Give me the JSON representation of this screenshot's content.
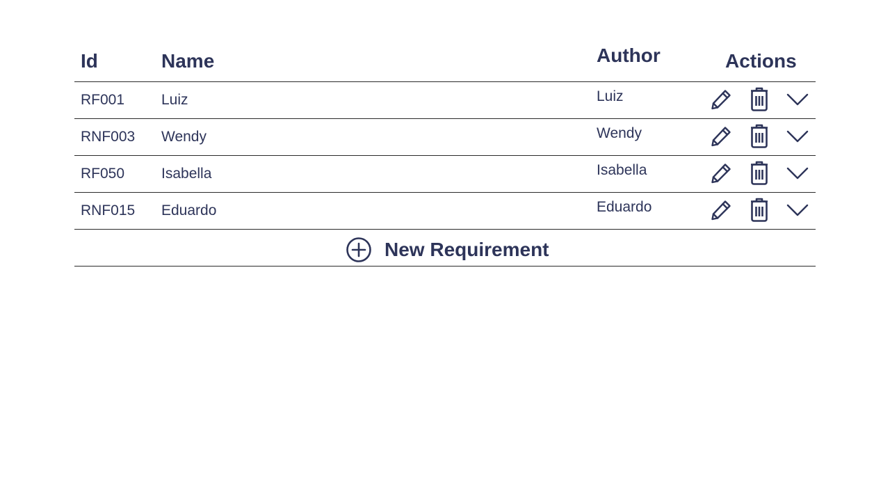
{
  "colors": {
    "text": "#2d3459",
    "divider": "#2a2a2a",
    "background": "#ffffff"
  },
  "table": {
    "headers": {
      "id": "Id",
      "name": "Name",
      "author": "Author",
      "actions": "Actions"
    },
    "rows": [
      {
        "id": "RF001",
        "name": "Luiz",
        "author": "Luiz"
      },
      {
        "id": "RNF003",
        "name": "Wendy",
        "author": "Wendy"
      },
      {
        "id": "RF050",
        "name": "Isabella",
        "author": "Isabella"
      },
      {
        "id": "RNF015",
        "name": "Eduardo",
        "author": "Eduardo"
      }
    ],
    "row_actions": [
      "pencil-icon",
      "trash-icon",
      "chevron-down-icon"
    ]
  },
  "new_requirement": {
    "label": "New Requirement",
    "icon": "plus-circle-icon"
  }
}
